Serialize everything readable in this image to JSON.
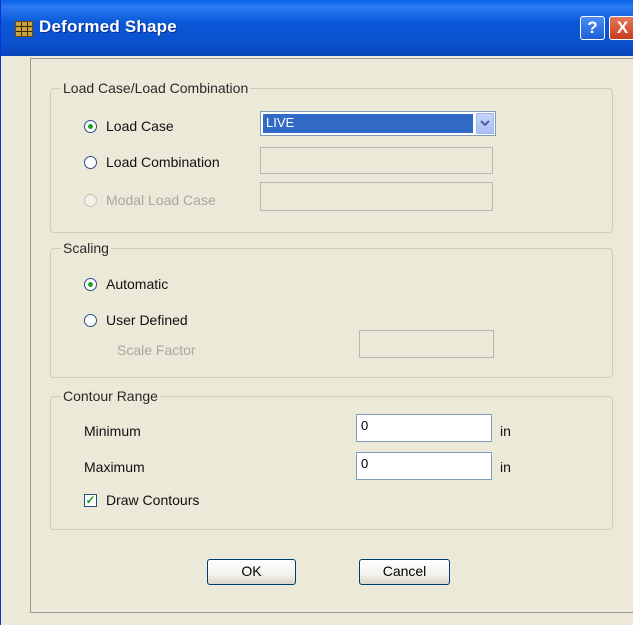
{
  "window": {
    "title": "Deformed Shape",
    "help_label": "?",
    "close_label": "X"
  },
  "load_group": {
    "title": "Load Case/Load Combination",
    "load_case_label": "Load Case",
    "load_case_selected": true,
    "load_case_value": "LIVE",
    "load_combination_label": "Load Combination",
    "load_combination_value": "",
    "modal_load_case_label": "Modal Load Case",
    "modal_load_case_value": ""
  },
  "scaling_group": {
    "title": "Scaling",
    "automatic_label": "Automatic",
    "automatic_selected": true,
    "user_defined_label": "User Defined",
    "scale_factor_label": "Scale Factor",
    "scale_factor_value": ""
  },
  "contour_group": {
    "title": "Contour Range",
    "minimum_label": "Minimum",
    "minimum_value": "0",
    "minimum_unit": "in",
    "maximum_label": "Maximum",
    "maximum_value": "0",
    "maximum_unit": "in",
    "draw_contours_label": "Draw Contours",
    "draw_contours_checked": true
  },
  "buttons": {
    "ok_label": "OK",
    "cancel_label": "Cancel"
  },
  "colors": {
    "titlebar": "#0a50cc",
    "dialog_bg": "#ece9d8",
    "selection": "#316ac5",
    "radio_dot": "#21a121"
  }
}
